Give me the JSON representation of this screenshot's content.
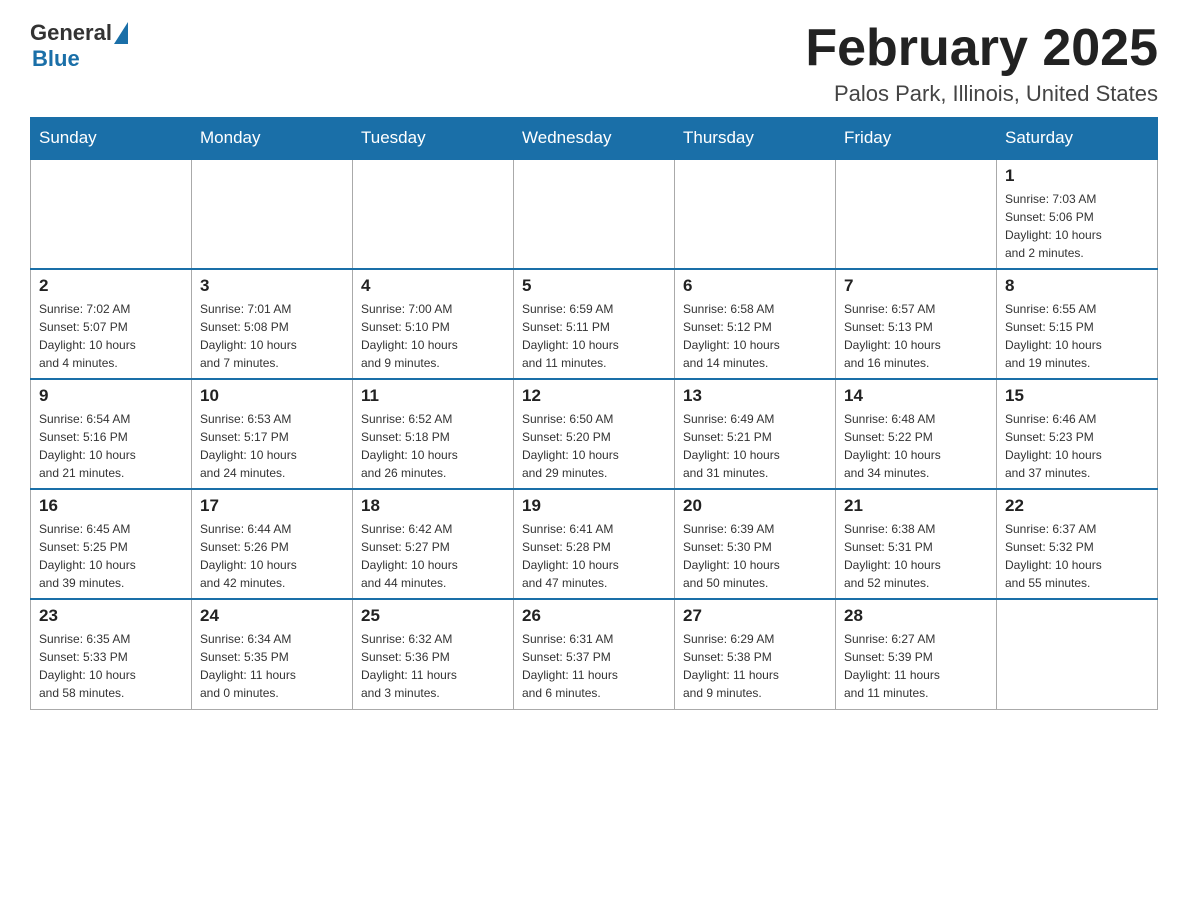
{
  "logo": {
    "general": "General",
    "blue": "Blue"
  },
  "title": "February 2025",
  "subtitle": "Palos Park, Illinois, United States",
  "days_of_week": [
    "Sunday",
    "Monday",
    "Tuesday",
    "Wednesday",
    "Thursday",
    "Friday",
    "Saturday"
  ],
  "weeks": [
    [
      {
        "day": "",
        "info": ""
      },
      {
        "day": "",
        "info": ""
      },
      {
        "day": "",
        "info": ""
      },
      {
        "day": "",
        "info": ""
      },
      {
        "day": "",
        "info": ""
      },
      {
        "day": "",
        "info": ""
      },
      {
        "day": "1",
        "info": "Sunrise: 7:03 AM\nSunset: 5:06 PM\nDaylight: 10 hours\nand 2 minutes."
      }
    ],
    [
      {
        "day": "2",
        "info": "Sunrise: 7:02 AM\nSunset: 5:07 PM\nDaylight: 10 hours\nand 4 minutes."
      },
      {
        "day": "3",
        "info": "Sunrise: 7:01 AM\nSunset: 5:08 PM\nDaylight: 10 hours\nand 7 minutes."
      },
      {
        "day": "4",
        "info": "Sunrise: 7:00 AM\nSunset: 5:10 PM\nDaylight: 10 hours\nand 9 minutes."
      },
      {
        "day": "5",
        "info": "Sunrise: 6:59 AM\nSunset: 5:11 PM\nDaylight: 10 hours\nand 11 minutes."
      },
      {
        "day": "6",
        "info": "Sunrise: 6:58 AM\nSunset: 5:12 PM\nDaylight: 10 hours\nand 14 minutes."
      },
      {
        "day": "7",
        "info": "Sunrise: 6:57 AM\nSunset: 5:13 PM\nDaylight: 10 hours\nand 16 minutes."
      },
      {
        "day": "8",
        "info": "Sunrise: 6:55 AM\nSunset: 5:15 PM\nDaylight: 10 hours\nand 19 minutes."
      }
    ],
    [
      {
        "day": "9",
        "info": "Sunrise: 6:54 AM\nSunset: 5:16 PM\nDaylight: 10 hours\nand 21 minutes."
      },
      {
        "day": "10",
        "info": "Sunrise: 6:53 AM\nSunset: 5:17 PM\nDaylight: 10 hours\nand 24 minutes."
      },
      {
        "day": "11",
        "info": "Sunrise: 6:52 AM\nSunset: 5:18 PM\nDaylight: 10 hours\nand 26 minutes."
      },
      {
        "day": "12",
        "info": "Sunrise: 6:50 AM\nSunset: 5:20 PM\nDaylight: 10 hours\nand 29 minutes."
      },
      {
        "day": "13",
        "info": "Sunrise: 6:49 AM\nSunset: 5:21 PM\nDaylight: 10 hours\nand 31 minutes."
      },
      {
        "day": "14",
        "info": "Sunrise: 6:48 AM\nSunset: 5:22 PM\nDaylight: 10 hours\nand 34 minutes."
      },
      {
        "day": "15",
        "info": "Sunrise: 6:46 AM\nSunset: 5:23 PM\nDaylight: 10 hours\nand 37 minutes."
      }
    ],
    [
      {
        "day": "16",
        "info": "Sunrise: 6:45 AM\nSunset: 5:25 PM\nDaylight: 10 hours\nand 39 minutes."
      },
      {
        "day": "17",
        "info": "Sunrise: 6:44 AM\nSunset: 5:26 PM\nDaylight: 10 hours\nand 42 minutes."
      },
      {
        "day": "18",
        "info": "Sunrise: 6:42 AM\nSunset: 5:27 PM\nDaylight: 10 hours\nand 44 minutes."
      },
      {
        "day": "19",
        "info": "Sunrise: 6:41 AM\nSunset: 5:28 PM\nDaylight: 10 hours\nand 47 minutes."
      },
      {
        "day": "20",
        "info": "Sunrise: 6:39 AM\nSunset: 5:30 PM\nDaylight: 10 hours\nand 50 minutes."
      },
      {
        "day": "21",
        "info": "Sunrise: 6:38 AM\nSunset: 5:31 PM\nDaylight: 10 hours\nand 52 minutes."
      },
      {
        "day": "22",
        "info": "Sunrise: 6:37 AM\nSunset: 5:32 PM\nDaylight: 10 hours\nand 55 minutes."
      }
    ],
    [
      {
        "day": "23",
        "info": "Sunrise: 6:35 AM\nSunset: 5:33 PM\nDaylight: 10 hours\nand 58 minutes."
      },
      {
        "day": "24",
        "info": "Sunrise: 6:34 AM\nSunset: 5:35 PM\nDaylight: 11 hours\nand 0 minutes."
      },
      {
        "day": "25",
        "info": "Sunrise: 6:32 AM\nSunset: 5:36 PM\nDaylight: 11 hours\nand 3 minutes."
      },
      {
        "day": "26",
        "info": "Sunrise: 6:31 AM\nSunset: 5:37 PM\nDaylight: 11 hours\nand 6 minutes."
      },
      {
        "day": "27",
        "info": "Sunrise: 6:29 AM\nSunset: 5:38 PM\nDaylight: 11 hours\nand 9 minutes."
      },
      {
        "day": "28",
        "info": "Sunrise: 6:27 AM\nSunset: 5:39 PM\nDaylight: 11 hours\nand 11 minutes."
      },
      {
        "day": "",
        "info": ""
      }
    ]
  ]
}
